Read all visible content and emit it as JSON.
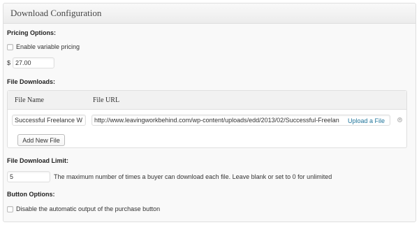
{
  "metabox": {
    "title": "Download Configuration"
  },
  "pricing": {
    "label": "Pricing Options:",
    "variable_pricing_label": "Enable variable pricing",
    "variable_pricing_checked": false,
    "currency_symbol": "$",
    "price_value": "27.00"
  },
  "downloads": {
    "label": "File Downloads:",
    "columns": [
      "File Name",
      "File URL"
    ],
    "files": [
      {
        "name": "Successful Freelance W",
        "url": "http://www.leavingworkbehind.com/wp-content/uploads/edd/2013/02/Successful-Freelan",
        "upload_label": "Upload a File",
        "remove_icon": "remove-circle-icon"
      }
    ],
    "add_button_label": "Add New File"
  },
  "limit": {
    "label": "File Download Limit:",
    "value": "5",
    "help_text": "The maximum number of times a buyer can download each file. Leave blank or set to 0 for unlimited"
  },
  "button_options": {
    "label": "Button Options:",
    "disable_label": "Disable the automatic output of the purchase button",
    "disable_checked": false
  },
  "colors": {
    "link": "#21759b",
    "border": "#dfdfdf"
  }
}
